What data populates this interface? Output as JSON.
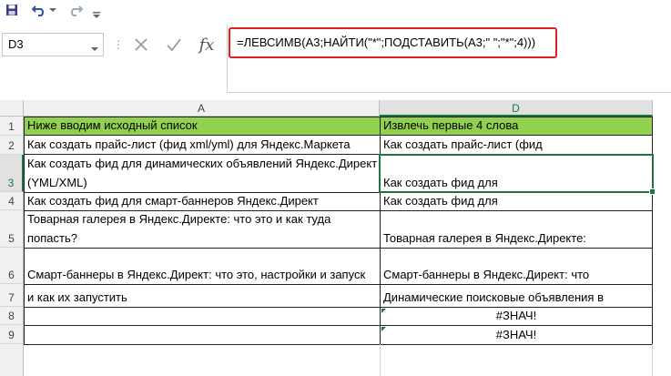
{
  "qat": {
    "icons": [
      "save-icon",
      "undo-icon",
      "undo-dropdown-icon",
      "redo-icon",
      "customize-dropdown-icon"
    ]
  },
  "namebox": {
    "value": "D3"
  },
  "formula_bar": {
    "formula": "=ЛЕВСИМВ(A3;НАЙТИ(\"*\";ПОДСТАВИТЬ(A3;\" \";\"*\";4)))",
    "fx_label": "fx"
  },
  "columns": [
    {
      "label": "A"
    },
    {
      "label": "D"
    }
  ],
  "rows": [
    {
      "num": "1",
      "a": "Ниже вводим исходный список",
      "d": "Извлечь первые 4 слова"
    },
    {
      "num": "2",
      "a": "Как создать прайс-лист (фид xml/yml) для Яндекс.Маркета",
      "d": "Как создать прайс-лист (фид"
    },
    {
      "num": "3",
      "a": "Как создать фид для динамических объявлений Яндекс.Директ (YML/XML)",
      "d": "Как создать фид для"
    },
    {
      "num": "4",
      "a": "Как создать фид для смарт-баннеров Яндекс.Директ",
      "d": "Как создать фид для"
    },
    {
      "num": "5",
      "a": "Товарная галерея в Яндекс.Директе: что это и как туда попасть?",
      "d": "Товарная галерея в Яндекс.Директе:"
    },
    {
      "num": "6",
      "a": "Смарт-баннеры в Яндекс.Директ: что это, настройки и запуск",
      "d": "Смарт-баннеры в Яндекс.Директ: что"
    },
    {
      "num": "7",
      "a": "и как их запустить",
      "d": "Динамические поисковые объявления в"
    },
    {
      "num": "8",
      "a": "",
      "d": "#ЗНАЧ!"
    },
    {
      "num": "9",
      "a": "",
      "d": "#ЗНАЧ!"
    },
    {
      "num": "",
      "a": "",
      "d": ""
    }
  ],
  "colors": {
    "header_fill": "#92d050",
    "selection": "#217346",
    "highlight": "#e02020"
  }
}
